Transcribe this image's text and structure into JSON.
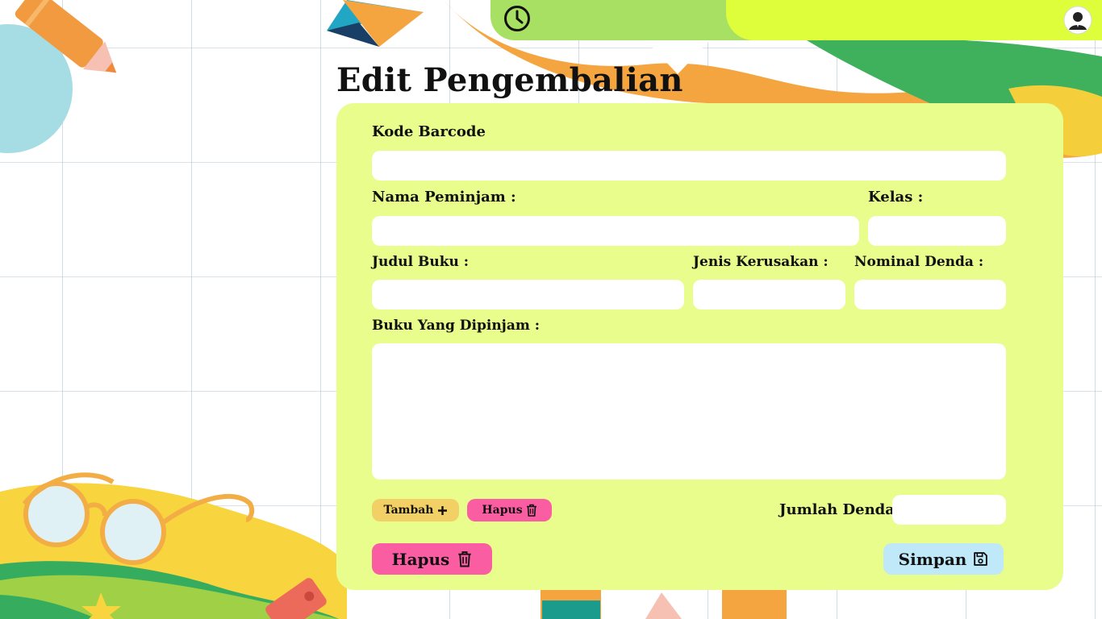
{
  "page": {
    "title": "Edit Pengembalian"
  },
  "topbar": {
    "clock_icon": "clock-icon",
    "avatar_icon": "user-avatar-icon"
  },
  "form": {
    "kode_barcode": {
      "label": "Kode Barcode",
      "value": ""
    },
    "nama_peminjam": {
      "label": "Nama Peminjam :",
      "value": ""
    },
    "kelas": {
      "label": "Kelas :",
      "value": ""
    },
    "judul_buku": {
      "label": "Judul Buku :",
      "value": ""
    },
    "jenis_kerusakan": {
      "label": "Jenis Kerusakan :",
      "value": ""
    },
    "nominal_denda": {
      "label": "Nominal Denda :",
      "value": ""
    },
    "buku_dipinjam": {
      "label": "Buku Yang Dipinjam :",
      "value": ""
    },
    "jumlah_denda": {
      "label": "Jumlah Denda :",
      "value": ""
    }
  },
  "buttons": {
    "tambah": {
      "label": "Tambah",
      "icon": "plus-icon"
    },
    "hapus_item": {
      "label": "Hapus",
      "icon": "trash-icon"
    },
    "hapus": {
      "label": "Hapus",
      "icon": "trash-icon"
    },
    "simpan": {
      "label": "Simpan",
      "icon": "save-icon"
    }
  },
  "colors": {
    "card": "#e8fd8b",
    "topbar_green": "#a8e063",
    "topbar_yellow": "#defd3a",
    "tambah": "#f3d065",
    "hapus": "#fb5da3",
    "simpan": "#bfe9f8"
  }
}
